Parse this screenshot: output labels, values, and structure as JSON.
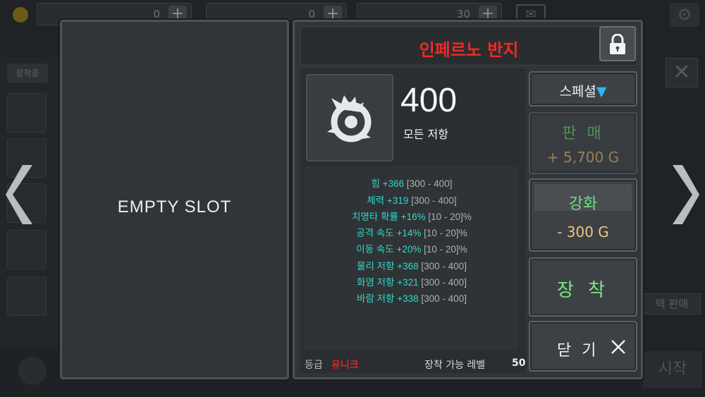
{
  "background": {
    "resources": [
      {
        "value": "0",
        "plus": "+"
      },
      {
        "value": "0",
        "plus": "+"
      },
      {
        "value": "30",
        "plus": "+"
      }
    ],
    "equipped_tab": "장착중",
    "sell_selected": "택 판매",
    "start": "시작",
    "close_symbol": "✕",
    "settings_symbol": "⚙",
    "mail_symbol": "✉"
  },
  "empty_slot": "EMPTY SLOT",
  "item": {
    "name": "인페르노 반지",
    "main_stat_value": "400",
    "main_stat_label": "모든 저항",
    "stats": [
      {
        "text": "힘 +366",
        "range": "[300 - 400]",
        "suffix": ""
      },
      {
        "text": "체력 +319",
        "range": "[300 - 400]",
        "suffix": ""
      },
      {
        "text": "치명타 확률 +16%",
        "range": "[10 - 20]",
        "suffix": "%"
      },
      {
        "text": "공격 속도 +14%",
        "range": "[10 - 20]",
        "suffix": "%"
      },
      {
        "text": "이동 속도 +20%",
        "range": "[10 - 20]",
        "suffix": "%"
      },
      {
        "text": "물리 저항 +368",
        "range": "[300 - 400]",
        "suffix": ""
      },
      {
        "text": "화염 저항 +321",
        "range": "[300 - 400]",
        "suffix": ""
      },
      {
        "text": "바람 저항 +338",
        "range": "[300 - 400]",
        "suffix": ""
      }
    ],
    "grade_label": "등급",
    "grade_value": "유니크",
    "required_level_label": "장착 가능 레벨",
    "required_level_value": "50"
  },
  "buttons": {
    "special": "스페셜",
    "special_arrow": "▼",
    "sell_label": "판 매",
    "sell_amount": "+ 5,700 G",
    "enhance_label": "강화",
    "enhance_cost": "- 300 G",
    "equip_label": "장 착",
    "close_label": "닫 기"
  },
  "colors": {
    "item_name": "#ef2a24",
    "grade_unique": "#e8221c",
    "stat_highlight": "#2fd8c9",
    "stat_range": "#a9b0b4",
    "button_green": "#6de07a",
    "gold": "#f1c37a",
    "special_arrow": "#27b8f0"
  },
  "icons": {
    "item": "inferno-ring-icon",
    "lock": "lock-icon",
    "close": "close-x-icon",
    "prev": "chevron-left-icon",
    "next": "chevron-right-icon"
  }
}
